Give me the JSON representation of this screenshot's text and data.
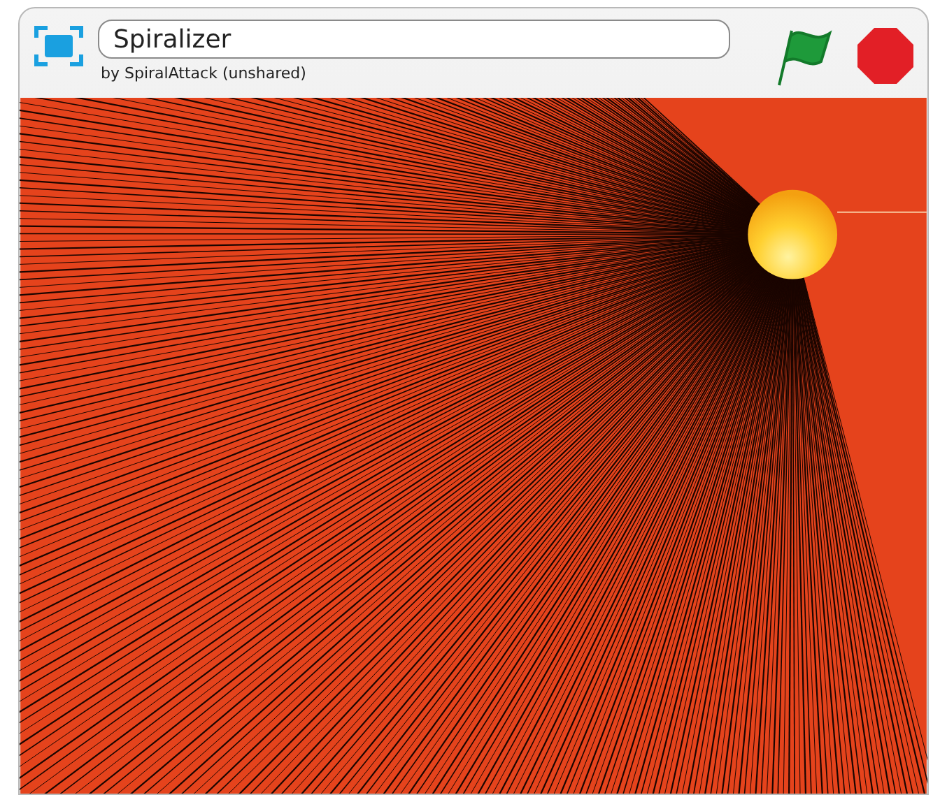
{
  "project": {
    "title": "Spiralizer",
    "author": "by SpiralAttack (unshared)"
  }
}
